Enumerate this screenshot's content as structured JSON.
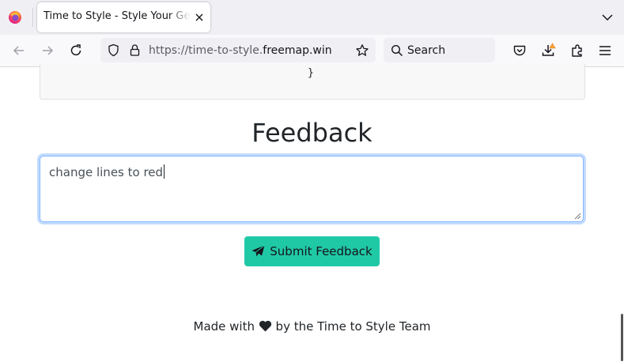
{
  "browser": {
    "tab_title": "Time to Style - Style Your GeoJSON",
    "url_prefix": "https://time-to-style.",
    "url_domain": "freemap.win",
    "search_placeholder": "Search"
  },
  "page": {
    "code_snippet_end": "}",
    "feedback_heading": "Feedback",
    "feedback_value": "change lines to red",
    "submit_label": "Submit Feedback",
    "footer_before": "Made with",
    "footer_after": "by the Time to Style Team"
  },
  "colors": {
    "accent": "#20c9a6",
    "focus_ring": "#86b7fe"
  }
}
